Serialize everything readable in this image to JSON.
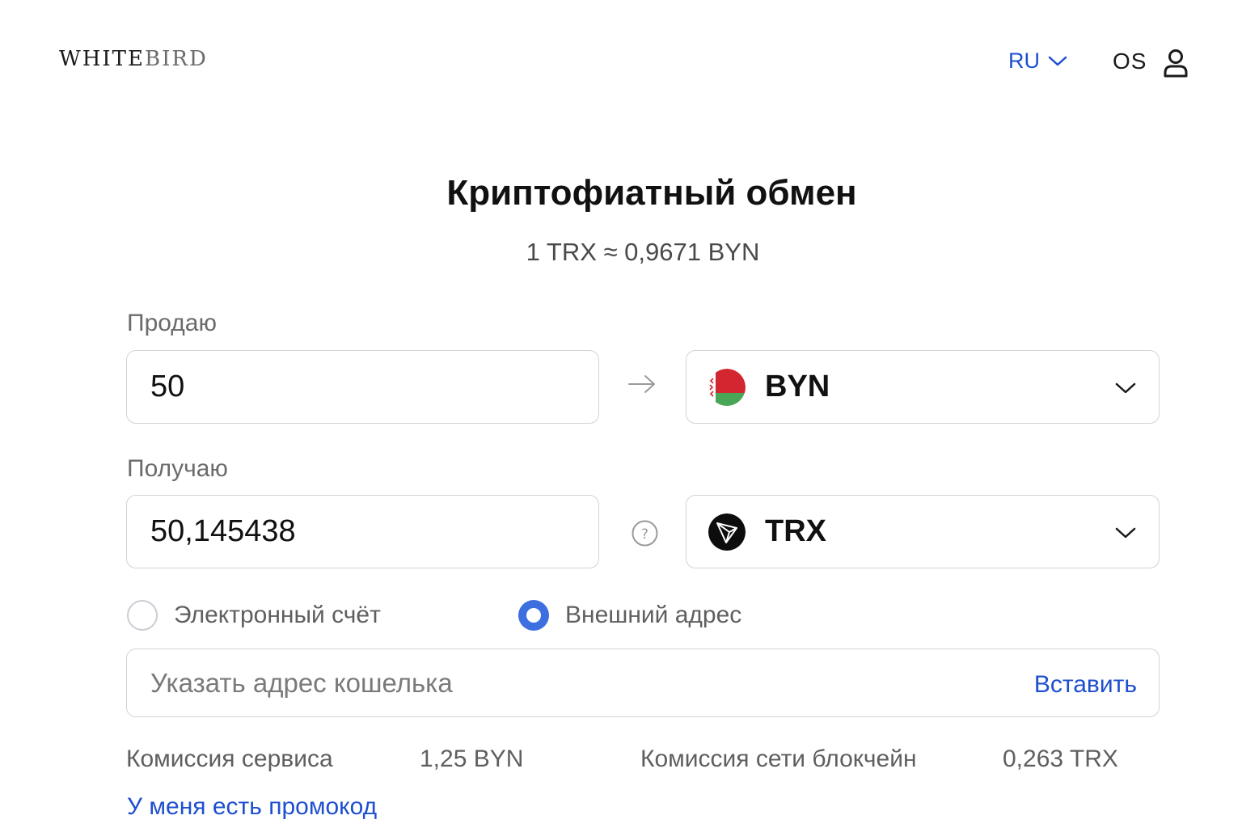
{
  "header": {
    "logo_left": "WHITE",
    "logo_right": "BIRD",
    "language": "RU",
    "user_initials": "OS"
  },
  "main": {
    "title": "Криптофиатный обмен",
    "rate": "1 TRX ≈ 0,9671 BYN",
    "sell": {
      "label": "Продаю",
      "amount": "50",
      "currency": "BYN",
      "currency_icon": "belarus-flag-icon"
    },
    "receive": {
      "label": "Получаю",
      "amount": "50,145438",
      "currency": "TRX",
      "currency_icon": "tron-logo-icon"
    },
    "destination": {
      "options": [
        {
          "label": "Электронный счёт",
          "selected": false
        },
        {
          "label": "Внешний адрес",
          "selected": true
        }
      ]
    },
    "wallet": {
      "placeholder": "Указать адрес кошелька",
      "paste_label": "Вставить"
    },
    "fees": {
      "service_label": "Комиссия сервиса",
      "service_value": "1,25 BYN",
      "network_label": "Комиссия сети блокчейн",
      "network_value": "0,263 TRX"
    },
    "promo_link": "У меня есть промокод"
  },
  "colors": {
    "accent": "#1e4fcf",
    "radio_selected": "#3d6fe0",
    "belarus_red": "#d22730",
    "belarus_green": "#4aa657"
  }
}
